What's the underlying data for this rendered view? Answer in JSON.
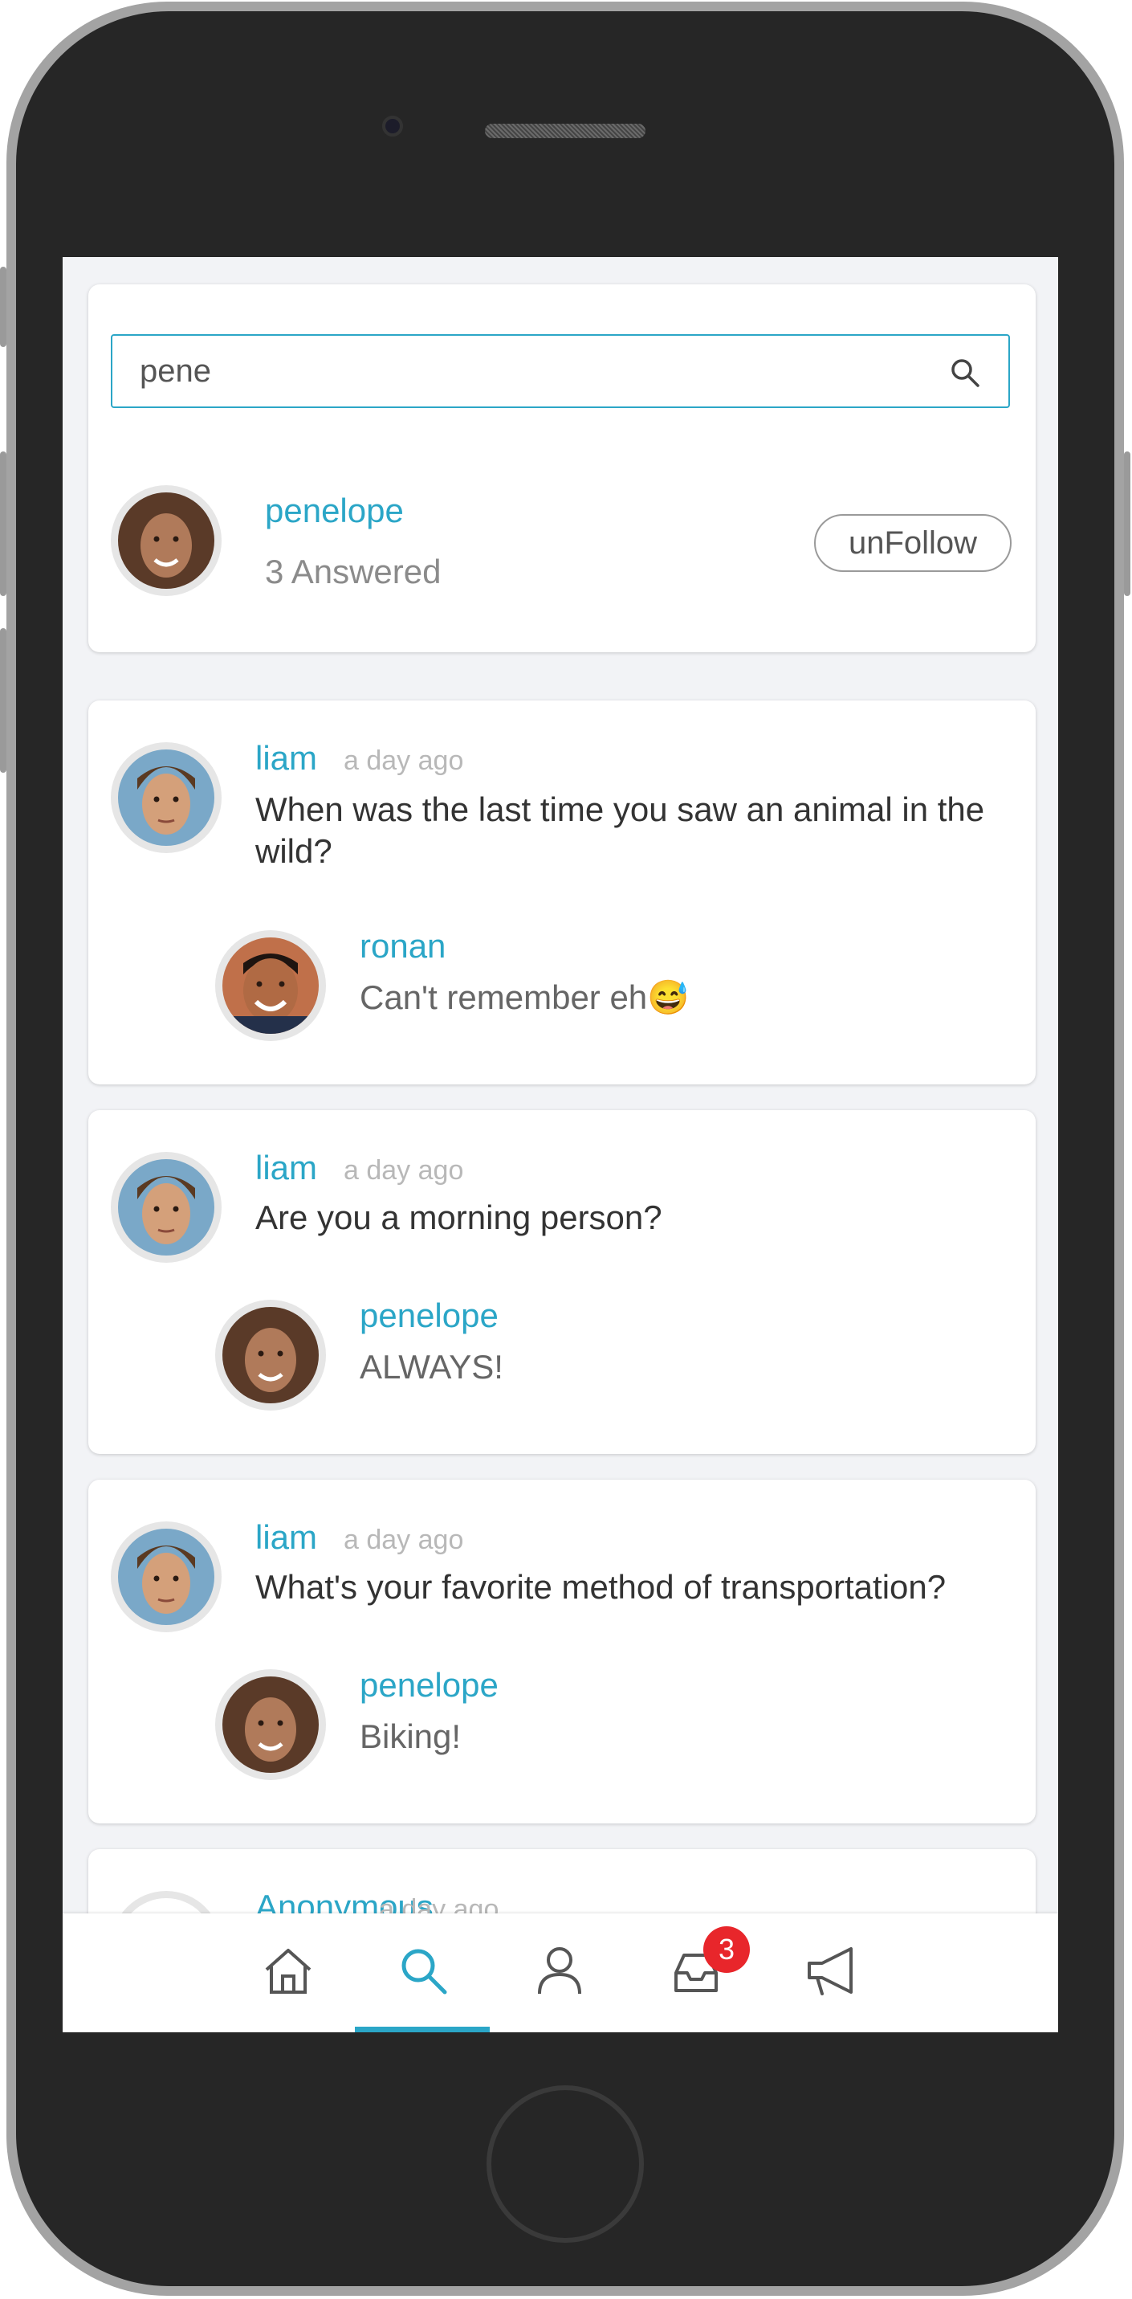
{
  "search": {
    "value": "pene",
    "placeholder": "Search"
  },
  "user_result": {
    "name": "penelope",
    "answered": "3 Answered",
    "follow_label": "unFollow"
  },
  "feed": [
    {
      "asker": "liam",
      "time": "a day ago",
      "question": "When was the last time you saw an animal in the wild?",
      "answerer": "ronan",
      "answer": "Can't remember eh",
      "emoji": "😅"
    },
    {
      "asker": "liam",
      "time": "a day ago",
      "question": "Are you a morning person?",
      "answerer": "penelope",
      "answer": "ALWAYS!"
    },
    {
      "asker": "liam",
      "time": "a day ago",
      "question": "What's your favorite method of transportation?",
      "answerer": "penelope",
      "answer": "Biking!"
    },
    {
      "asker": "Anonymous",
      "time": "a day ago"
    }
  ],
  "tabs": [
    {
      "icon": "home-icon",
      "active": false
    },
    {
      "icon": "search-icon",
      "active": true
    },
    {
      "icon": "profile-icon",
      "active": false
    },
    {
      "icon": "inbox-icon",
      "active": false,
      "badge": "3"
    },
    {
      "icon": "megaphone-icon",
      "active": false
    }
  ],
  "colors": {
    "accent": "#2ba6c7",
    "badge": "#e8262b",
    "background": "#f2f3f6"
  }
}
